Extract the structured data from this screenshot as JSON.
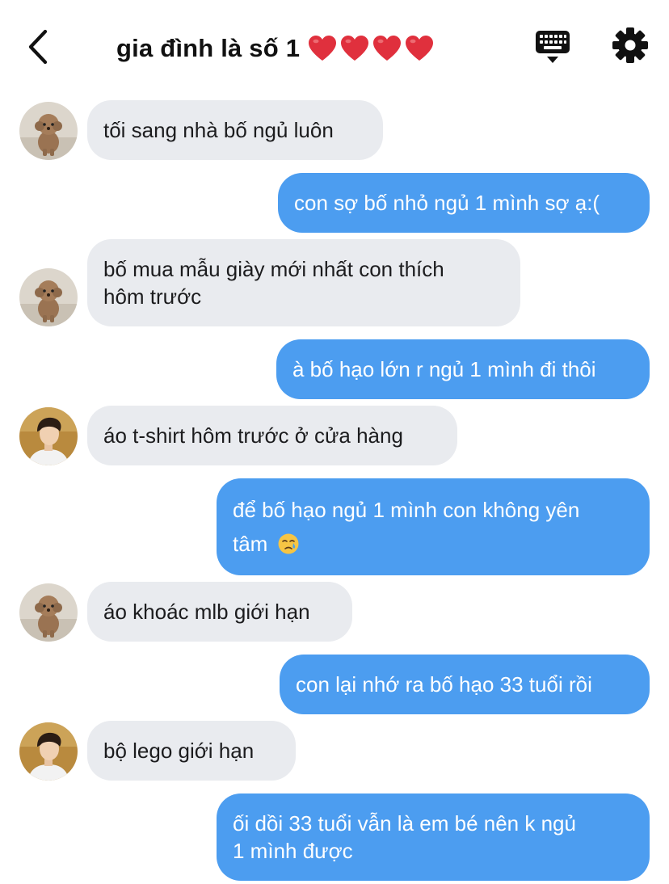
{
  "header": {
    "title": "gia đình là số 1",
    "icons": [
      "back-chevron-icon",
      "heart-icon",
      "heart-icon",
      "heart-icon",
      "heart-icon",
      "keyboard-icon",
      "gear-icon"
    ],
    "heart_color": "#e0303d"
  },
  "colors": {
    "incoming_bubble": "#e9ebef",
    "outgoing_bubble": "#4c9df0",
    "outgoing_text": "#ffffff"
  },
  "messages": [
    {
      "side": "in",
      "avatar": "dog",
      "lines": [
        "tối sang nhà bố ngủ luôn"
      ]
    },
    {
      "side": "out",
      "lines": [
        "con sợ bố nhỏ ngủ 1 mình sợ ạ:("
      ]
    },
    {
      "side": "in",
      "avatar": "dog",
      "lines": [
        "bố mua mẫu giày mới nhất con thích",
        "hôm trước"
      ]
    },
    {
      "side": "out",
      "lines": [
        "à bố hạo lớn r ngủ 1 mình đi thôi"
      ]
    },
    {
      "side": "in",
      "avatar": "boy",
      "lines": [
        "áo t-shirt hôm trước ở cửa hàng"
      ]
    },
    {
      "side": "out",
      "lines": [
        "để bố hạo ngủ 1 mình con không yên",
        "tâm"
      ],
      "trailing_emoji": "crying-face-icon"
    },
    {
      "side": "in",
      "avatar": "dog",
      "lines": [
        "áo khoác mlb giới hạn"
      ]
    },
    {
      "side": "out",
      "lines": [
        "con lại nhớ ra bố hạo 33 tuổi rồi"
      ]
    },
    {
      "side": "in",
      "avatar": "boy",
      "lines": [
        "bộ lego giới hạn"
      ]
    },
    {
      "side": "out",
      "lines": [
        "ối dồi 33 tuổi vẫn là em bé nên k ngủ",
        "1 mình được"
      ]
    }
  ]
}
